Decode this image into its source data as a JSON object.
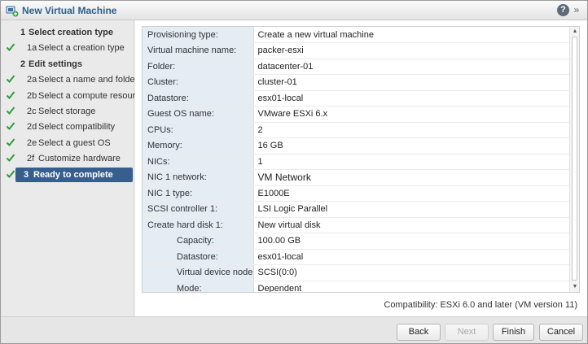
{
  "window": {
    "title": "New Virtual Machine",
    "help_label": "?",
    "more_label": "»"
  },
  "steps": [
    {
      "num": "1",
      "label": "Select creation type",
      "kind": "group",
      "done": false,
      "active": false
    },
    {
      "num": "1a",
      "label": "Select a creation type",
      "kind": "item",
      "done": true,
      "active": false
    },
    {
      "num": "2",
      "label": "Edit settings",
      "kind": "group",
      "done": false,
      "active": false
    },
    {
      "num": "2a",
      "label": "Select a name and folder",
      "kind": "item",
      "done": true,
      "active": false
    },
    {
      "num": "2b",
      "label": "Select a compute resource",
      "kind": "item",
      "done": true,
      "active": false
    },
    {
      "num": "2c",
      "label": "Select storage",
      "kind": "item",
      "done": true,
      "active": false
    },
    {
      "num": "2d",
      "label": "Select compatibility",
      "kind": "item",
      "done": true,
      "active": false
    },
    {
      "num": "2e",
      "label": "Select a guest OS",
      "kind": "item",
      "done": true,
      "active": false
    },
    {
      "num": "2f",
      "label": "Customize hardware",
      "kind": "item",
      "done": true,
      "active": false
    },
    {
      "num": "3",
      "label": "Ready to complete",
      "kind": "group",
      "done": true,
      "active": true
    }
  ],
  "summary": {
    "rows": [
      {
        "key": "Provisioning type:",
        "value": "Create a new virtual machine",
        "sub": false
      },
      {
        "key": "Virtual machine name:",
        "value": "packer-esxi",
        "sub": false
      },
      {
        "key": "Folder:",
        "value": "datacenter-01",
        "sub": false
      },
      {
        "key": "Cluster:",
        "value": "cluster-01",
        "sub": false
      },
      {
        "key": "Datastore:",
        "value": "esx01-local",
        "sub": false
      },
      {
        "key": "Guest OS name:",
        "value": "VMware ESXi 6.x",
        "sub": false
      },
      {
        "key": "CPUs:",
        "value": "2",
        "sub": false
      },
      {
        "key": "Memory:",
        "value": "16 GB",
        "sub": false
      },
      {
        "key": "NICs:",
        "value": "1",
        "sub": false
      },
      {
        "key": "NIC 1 network:",
        "value": "VM Network",
        "sub": false,
        "big": true
      },
      {
        "key": "NIC 1 type:",
        "value": "E1000E",
        "sub": false
      },
      {
        "key": "SCSI controller 1:",
        "value": "LSI Logic Parallel",
        "sub": false
      },
      {
        "key": "Create hard disk 1:",
        "value": "New virtual disk",
        "sub": false
      },
      {
        "key": "Capacity:",
        "value": "100.00 GB",
        "sub": true
      },
      {
        "key": "Datastore:",
        "value": "esx01-local",
        "sub": true
      },
      {
        "key": "Virtual device node:",
        "value": "SCSI(0:0)",
        "sub": true
      },
      {
        "key": "Mode:",
        "value": "Dependent",
        "sub": true
      }
    ]
  },
  "compatibility": "Compatibility: ESXi 6.0 and later (VM version 11)",
  "buttons": {
    "back": "Back",
    "next": "Next",
    "finish": "Finish",
    "cancel": "Cancel"
  },
  "colors": {
    "active_step": "#365f8d",
    "check": "#2f9e3a",
    "key_cell": "#e4ecf4",
    "title": "#2d5f8a"
  }
}
